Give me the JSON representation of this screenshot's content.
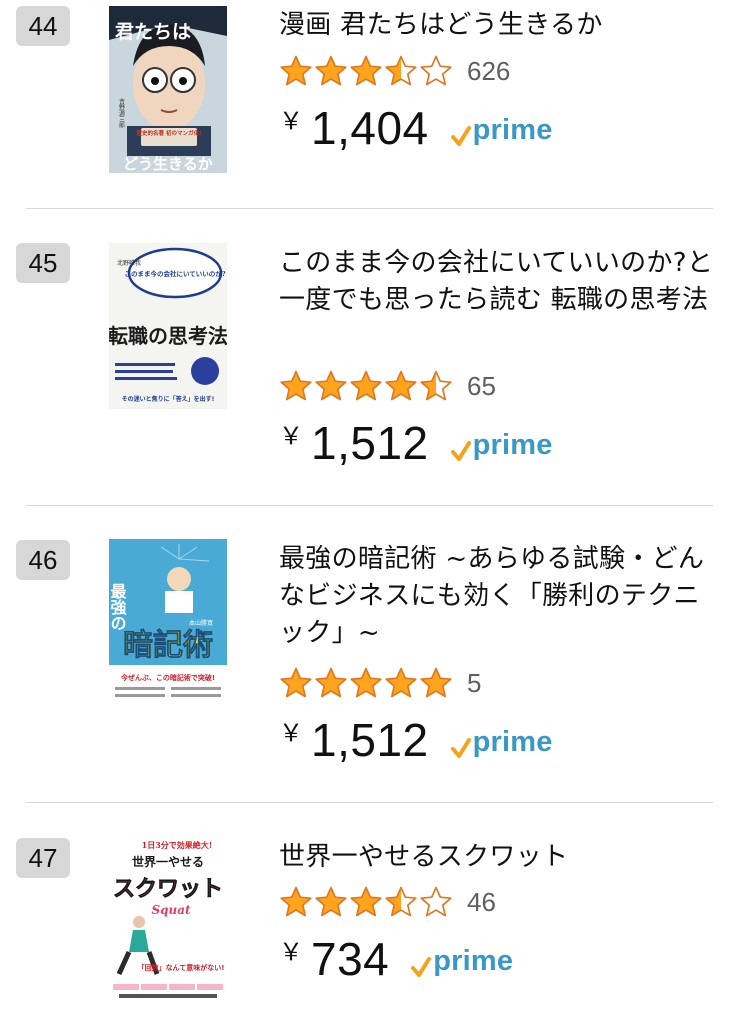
{
  "colors": {
    "star_fill": "#ffa41c",
    "star_outline": "#de7921",
    "prime_blue": "#3a98c7",
    "prime_check": "#f7a11b",
    "rank_badge_bg": "#d7d7d7"
  },
  "currency": "￥",
  "prime_label": "prime",
  "items": [
    {
      "rank": "44",
      "title": "漫画 君たちはどう生きるか",
      "rating": 3.5,
      "review_count": "626",
      "price": "1,404",
      "cover": {
        "bg": "#c9d6de",
        "title_text": "君たちは",
        "bottom_text": "どう生きるか",
        "author_text": "吉野源三郎",
        "band_text": "歴史的名著 初のマンガ化!"
      }
    },
    {
      "rank": "45",
      "title": "このまま今の会社にいていいのか?と一度でも思ったら読む 転職の思考法",
      "rating": 4.5,
      "review_count": "65",
      "price": "1,512",
      "cover": {
        "bg": "#f4f4f1",
        "bubble_text": "このまま今の会社にいていいのか?",
        "author_text": "北野唯我",
        "main_text": "転職の思考法",
        "band_text": "その迷いと焦りに「答え」を出す!"
      }
    },
    {
      "rank": "46",
      "title": "最強の暗記術 ~あらゆる試験・どんなビジネスにも効く「勝利のテクニック」~",
      "rating": 5,
      "review_count": "5",
      "price": "1,512",
      "cover": {
        "bg": "#4aaad6",
        "top_text": "最強の",
        "main_text": "暗記術",
        "author_text": "本山勝寛",
        "band_text": "今ぜんぶ、この暗記術で突破!"
      }
    },
    {
      "rank": "47",
      "title": "世界一やせるスクワット",
      "rating": 3.5,
      "review_count": "46",
      "price": "734",
      "cover": {
        "bg": "#ffffff",
        "top_text": "1日3分で効果絶大!",
        "sub_text": "世界一やせる",
        "main_text": "スクワット",
        "script_text": "Squat",
        "band_text": "「回数」なんて意味がない!"
      }
    }
  ]
}
